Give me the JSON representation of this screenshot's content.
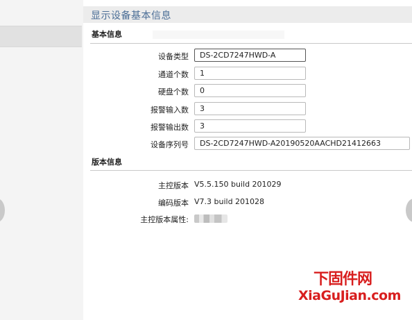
{
  "page_title": "显示设备基本信息",
  "basic_section": {
    "heading": "基本信息",
    "fields": [
      {
        "label": "设备类型",
        "value": "DS-2CD7247HWD-A"
      },
      {
        "label": "通道个数",
        "value": "1"
      },
      {
        "label": "硬盘个数",
        "value": "0"
      },
      {
        "label": "报警输入数",
        "value": "3"
      },
      {
        "label": "报警输出数",
        "value": "3"
      },
      {
        "label": "设备序列号",
        "value": "DS-2CD7247HWD-A20190520AACHD21412663"
      }
    ]
  },
  "version_section": {
    "heading": "版本信息",
    "rows": [
      {
        "label": "主控版本",
        "value": "V5.5.150 build 201029"
      },
      {
        "label": "编码版本",
        "value": "V7.3 build 201028"
      },
      {
        "label": "主控版本属性:"
      }
    ]
  },
  "watermark": {
    "cn": "下固件网",
    "en": "XiaGuJian.com",
    "color": "#d81e1e"
  },
  "colors": {
    "title_text": "#4a6d96",
    "title_bar_bg": "#ececec",
    "panel_bg": "#ffffff"
  }
}
